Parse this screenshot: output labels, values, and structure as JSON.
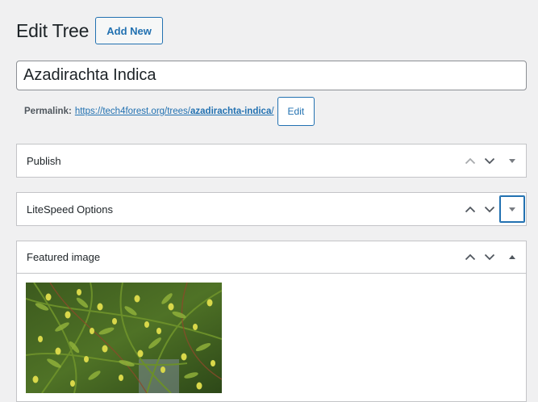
{
  "header": {
    "title": "Edit Tree",
    "add_new_label": "Add New"
  },
  "post": {
    "title_value": "Azadirachta Indica"
  },
  "permalink": {
    "label": "Permalink:",
    "base_url": "https://tech4forest.org/trees/",
    "slug": "azadirachta-indica",
    "trailing": "/",
    "edit_label": "Edit"
  },
  "boxes": [
    {
      "title": "Publish",
      "state": "collapsed"
    },
    {
      "title": "LiteSpeed Options",
      "state": "collapsed",
      "toggle_focused": true
    },
    {
      "title": "Featured image",
      "state": "expanded"
    }
  ],
  "icons": {
    "move_up": "chevron-up-icon",
    "move_down": "chevron-down-icon",
    "toggle_closed": "triangle-down-icon",
    "toggle_open": "triangle-up-icon"
  },
  "colors": {
    "background": "#f0f0f1",
    "accent": "#2271b1",
    "border": "#c3c4c7",
    "text": "#1d2327",
    "icon": "#50575e"
  },
  "featured_image": {
    "description_icon": "neem-leaves-image"
  }
}
